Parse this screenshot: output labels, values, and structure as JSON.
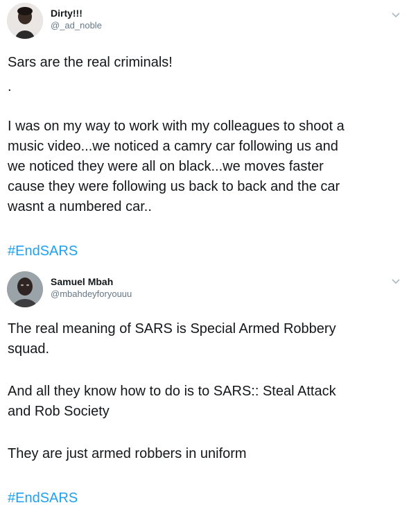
{
  "tweets": [
    {
      "display_name": "Dirty!!!",
      "handle": "@_ad_noble",
      "avatar_icon": "user-avatar-photo",
      "menu_icon": "chevron-down-icon",
      "text_line1": "Sars are the real criminals!",
      "text_dot": ".",
      "text_paragraph": "I was on my way to work with my colleagues to shoot a\nmusic video...we noticed a camry car following us and\nwe noticed they were all on black...we moves faster\ncause they were following us back to back and the car\nwasnt a numbered car..",
      "hashtag": "#EndSARS"
    },
    {
      "display_name": "Samuel Mbah",
      "handle": "@mbahdeyforyouuu",
      "avatar_icon": "user-avatar-photo",
      "menu_icon": "chevron-down-icon",
      "text_paragraph1": "The real meaning of SARS is Special Armed Robbery\nsquad.",
      "text_paragraph2": "And all they know how to do is to SARS:: Steal Attack\nand Rob Society",
      "text_paragraph3": "They are just armed robbers in uniform",
      "hashtag": "#EndSARS"
    }
  ],
  "colors": {
    "text_primary": "#14171a",
    "text_secondary": "#657786",
    "link": "#1da1f2",
    "caret": "#aab8c2"
  }
}
